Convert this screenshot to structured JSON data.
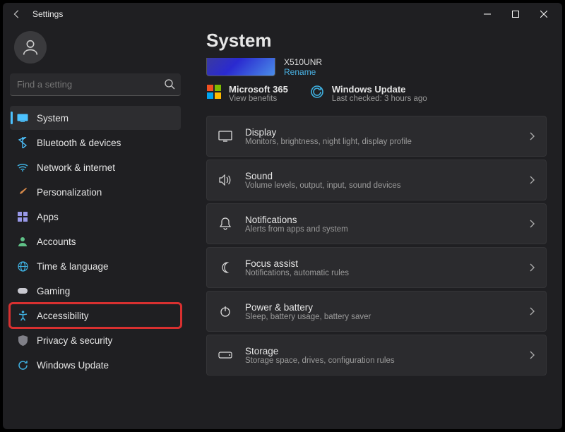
{
  "titlebar": {
    "title": "Settings"
  },
  "search": {
    "placeholder": "Find a setting"
  },
  "nav": {
    "items": [
      {
        "label": "System",
        "icon": "display",
        "color": "#4cc2ff"
      },
      {
        "label": "Bluetooth & devices",
        "icon": "bluetooth",
        "color": "#4cc2ff"
      },
      {
        "label": "Network & internet",
        "icon": "wifi",
        "color": "#3fb0e0"
      },
      {
        "label": "Personalization",
        "icon": "brush",
        "color": "#d88a4a"
      },
      {
        "label": "Apps",
        "icon": "apps",
        "color": "#c8c8ff"
      },
      {
        "label": "Accounts",
        "icon": "person",
        "color": "#5fc087"
      },
      {
        "label": "Time & language",
        "icon": "globe",
        "color": "#3fb0e0"
      },
      {
        "label": "Gaming",
        "icon": "gaming",
        "color": "#c8c8d0"
      },
      {
        "label": "Accessibility",
        "icon": "accessibility",
        "color": "#3fb0e0"
      },
      {
        "label": "Privacy & security",
        "icon": "shield",
        "color": "#808088"
      },
      {
        "label": "Windows Update",
        "icon": "update",
        "color": "#3fb0e0"
      }
    ]
  },
  "page": {
    "title": "System",
    "device": {
      "name": "X510UNR",
      "rename": "Rename"
    },
    "info": [
      {
        "title": "Microsoft 365",
        "sub": "View benefits",
        "icon": "ms365"
      },
      {
        "title": "Windows Update",
        "sub": "Last checked: 3 hours ago",
        "icon": "update"
      }
    ],
    "settings": [
      {
        "title": "Display",
        "sub": "Monitors, brightness, night light, display profile",
        "icon": "display"
      },
      {
        "title": "Sound",
        "sub": "Volume levels, output, input, sound devices",
        "icon": "sound"
      },
      {
        "title": "Notifications",
        "sub": "Alerts from apps and system",
        "icon": "bell"
      },
      {
        "title": "Focus assist",
        "sub": "Notifications, automatic rules",
        "icon": "moon"
      },
      {
        "title": "Power & battery",
        "sub": "Sleep, battery usage, battery saver",
        "icon": "power"
      },
      {
        "title": "Storage",
        "sub": "Storage space, drives, configuration rules",
        "icon": "storage"
      }
    ]
  }
}
